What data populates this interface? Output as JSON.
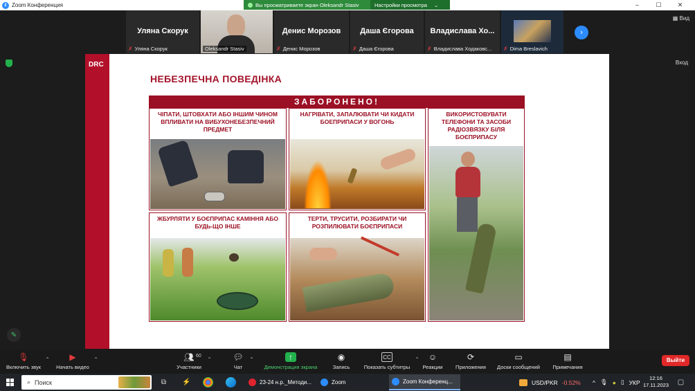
{
  "window": {
    "title": "Zoom Конференция",
    "controls": [
      "–",
      "☐",
      "✕"
    ]
  },
  "share_banner": {
    "text": "Вы просматриваете экран Oleksandr Stasiv",
    "options": "Настройки просмотра"
  },
  "participants": [
    {
      "big_name": "Уляна Скорук",
      "label": "Уляна Скорук",
      "muted": true,
      "video": false
    },
    {
      "big_name": "",
      "label": "Oleksandr Stasiv",
      "muted": false,
      "video": true
    },
    {
      "big_name": "Денис Морозов",
      "label": "Денис Морозов",
      "muted": true,
      "video": false
    },
    {
      "big_name": "Даша Єгорова",
      "label": "Даша Єгорова",
      "muted": true,
      "video": false
    },
    {
      "big_name": "Владислава Хо...",
      "label": "Владислава Ходаковс...",
      "muted": true,
      "video": false
    },
    {
      "big_name": "",
      "label": "Dima Breslavich",
      "muted": true,
      "video": true
    }
  ],
  "view_button": "Вид",
  "exit_button": "Вход",
  "slide": {
    "logo": "DRC",
    "heading": "НЕБЕЗПЕЧНА ПОВЕДІНКА",
    "banner": "ЗАБОРОНЕНО!",
    "panels": [
      {
        "caption": "ЧІПАТИ, ШТОВХАТИ АБО ІНШИМ ЧИНОМ ВПЛИВАТИ НА ВИБУХОНЕБЕЗПЕЧНИЙ ПРЕДМЕТ"
      },
      {
        "caption": "НАГРІВАТИ, ЗАПАЛЮВАТИ ЧИ КИДАТИ БОЕПРИПАСИ У ВОГОНЬ"
      },
      {
        "caption": "ВИКОРИСТОВУВАТИ ТЕЛЕФОНИ ТА ЗАСОБИ РАДІОЗВЯЗКУ БІЛЯ БОЄПРИПАСУ"
      },
      {
        "caption": "ЖБУРЛЯТИ У БОЄПРИПАС КАМІННЯ АБО БУДЬ-ЩО ІНШЕ"
      },
      {
        "caption": "ТЕРТИ, ТРУСИТИ, РОЗБИРАТИ ЧИ РОЗПИЛЮВАТИ БОЄПРИПАСИ"
      }
    ]
  },
  "toolbar": {
    "mute": "Включить звук",
    "video": "Начать видео",
    "participants": "Участники",
    "participants_count": "60",
    "chat": "Чат",
    "share": "Демонстрация экрана",
    "record": "Запись",
    "captions": "Показать субтитры",
    "reactions": "Реакции",
    "apps": "Приложения",
    "whiteboards": "Доски сообщений",
    "notes": "Примечания",
    "leave": "Выйти"
  },
  "taskbar": {
    "search_placeholder": "Поиск",
    "tasks": [
      {
        "label": "23-24 н.р._Методи...",
        "active": false
      },
      {
        "label": "Zoom",
        "active": false
      },
      {
        "label": "Zoom Конференц...",
        "active": true
      }
    ],
    "ticker_symbol": "USD/PKR",
    "ticker_change": "-0.52%",
    "language": "УКР",
    "time": "12:16",
    "date": "17.11.2023"
  },
  "colors": {
    "brand_red": "#b2102a",
    "zoom_blue": "#2d8cff",
    "share_green": "#2e8b3c",
    "leave_red": "#e02828"
  }
}
